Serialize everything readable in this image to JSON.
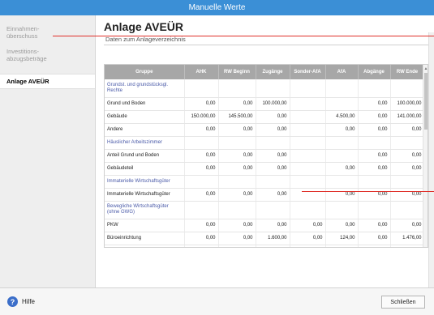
{
  "window": {
    "title": "Manuelle Werte"
  },
  "sidebar": {
    "items": [
      {
        "line1": "Einnahmen-",
        "line2": "überschuss"
      },
      {
        "line1": "Investitions-",
        "line2": "abzugsbeträge"
      },
      {
        "line1": "Anlage AVEÜR"
      }
    ]
  },
  "main": {
    "title": "Anlage AVEÜR",
    "subtitle": "Daten zum Anlageverzeichnis"
  },
  "table": {
    "headers": [
      "Gruppe",
      "AHK",
      "RW Beginn",
      "Zugänge",
      "Sonder-AfA",
      "AfA",
      "Abgänge",
      "RW Ende"
    ],
    "rows": [
      {
        "gruppe": "Grundst. und grundstücksgl. Rechte",
        "type": "section",
        "values": [
          "",
          "",
          "",
          "",
          "",
          "",
          ""
        ]
      },
      {
        "gruppe": "Grund und Boden",
        "values": [
          "0,00",
          "0,00",
          "100.000,00",
          "",
          "",
          "0,00",
          "100.000,00"
        ]
      },
      {
        "gruppe": "Gebäude",
        "values": [
          "150.000,00",
          "145.500,00",
          "0,00",
          "",
          "4.500,00",
          "0,00",
          "141.000,00"
        ]
      },
      {
        "gruppe": "Andere",
        "values": [
          "0,00",
          "0,00",
          "0,00",
          "",
          "0,00",
          "0,00",
          "0,00"
        ]
      },
      {
        "gruppe": "Häuslicher Arbeitszimmer",
        "type": "section",
        "values": [
          "",
          "",
          "",
          "",
          "",
          "",
          ""
        ]
      },
      {
        "gruppe": "Anteil Grund und Boden",
        "values": [
          "0,00",
          "0,00",
          "0,00",
          "",
          "",
          "0,00",
          "0,00"
        ]
      },
      {
        "gruppe": "Gebäudeteil",
        "values": [
          "0,00",
          "0,00",
          "0,00",
          "",
          "0,00",
          "0,00",
          "0,00"
        ]
      },
      {
        "gruppe": "Immaterielle Wirtschaftsgüter",
        "type": "section",
        "values": [
          "",
          "",
          "",
          "",
          "",
          "",
          ""
        ]
      },
      {
        "gruppe": "Immaterielle Wirtschaftsgüter",
        "values": [
          "0,00",
          "0,00",
          "0,00",
          "",
          "0,00",
          "0,00",
          "0,00"
        ]
      },
      {
        "gruppe": "Bewegliche Wirtschaftsgüter (ohne GWG)",
        "type": "section",
        "values": [
          "",
          "",
          "",
          "",
          "",
          "",
          ""
        ]
      },
      {
        "gruppe": "PKW",
        "values": [
          "0,00",
          "0,00",
          "0,00",
          "0,00",
          "0,00",
          "0,00",
          "0,00"
        ]
      },
      {
        "gruppe": "Büroeinrichtung",
        "values": [
          "0,00",
          "0,00",
          "1.600,00",
          "0,00",
          "124,00",
          "0,00",
          "1.476,00"
        ]
      },
      {
        "gruppe": "Andere",
        "values": [
          "0,00",
          "0,00",
          "0,00",
          "0,00",
          "0,00",
          "0,00",
          "0,00"
        ]
      }
    ]
  },
  "footer": {
    "help_label": "Hilfe",
    "close_label": "Schließen"
  },
  "colors": {
    "titlebar": "#3b8fd6",
    "section_text": "#4a5aa8",
    "header_bg": "#a7a7a7",
    "annotation_line": "#e0302a"
  },
  "icons": {
    "help": "help-icon",
    "scroll_up": "chevron-up-icon"
  }
}
